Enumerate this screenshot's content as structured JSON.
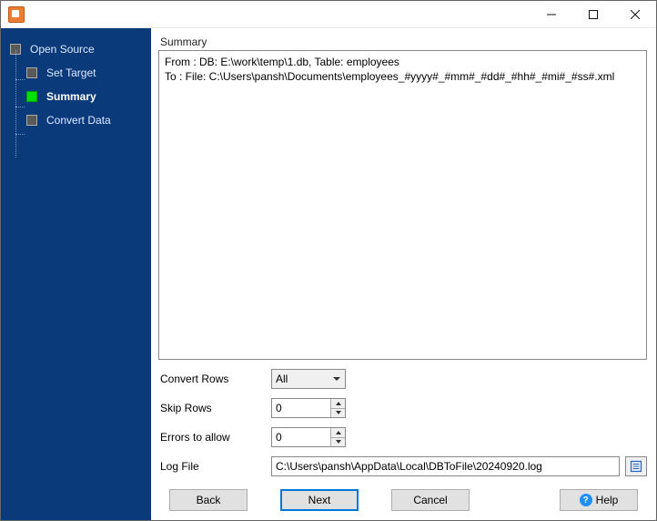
{
  "sidebar": {
    "items": [
      {
        "label": "Open Source",
        "active": false
      },
      {
        "label": "Set Target",
        "active": false
      },
      {
        "label": "Summary",
        "active": true
      },
      {
        "label": "Convert Data",
        "active": false
      }
    ]
  },
  "main": {
    "section_label": "Summary",
    "summary_text": "From : DB: E:\\work\\temp\\1.db, Table: employees\nTo : File: C:\\Users\\pansh\\Documents\\employees_#yyyy#_#mm#_#dd#_#hh#_#mi#_#ss#.xml"
  },
  "form": {
    "convert_rows_label": "Convert Rows",
    "convert_rows_value": "All",
    "skip_rows_label": "Skip Rows",
    "skip_rows_value": "0",
    "errors_label": "Errors to allow",
    "errors_value": "0",
    "logfile_label": "Log File",
    "logfile_value": "C:\\Users\\pansh\\AppData\\Local\\DBToFile\\20240920.log"
  },
  "footer": {
    "back": "Back",
    "next": "Next",
    "cancel": "Cancel",
    "help": "Help"
  }
}
